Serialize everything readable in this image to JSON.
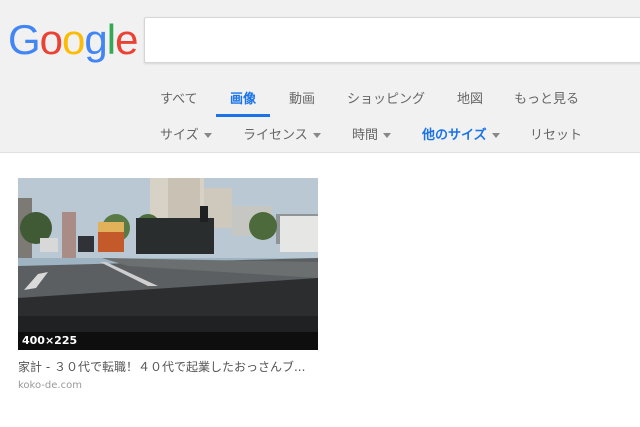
{
  "logo": {
    "letters": [
      "G",
      "o",
      "o",
      "g",
      "l",
      "e"
    ],
    "colors": [
      "#4285f4",
      "#ea4335",
      "#fbbc05",
      "#4285f4",
      "#34a853",
      "#ea4335"
    ]
  },
  "search": {
    "value": "",
    "placeholder": ""
  },
  "tabs": [
    {
      "label": "すべて",
      "active": false
    },
    {
      "label": "画像",
      "active": true
    },
    {
      "label": "動画",
      "active": false
    },
    {
      "label": "ショッピング",
      "active": false
    },
    {
      "label": "地図",
      "active": false
    },
    {
      "label": "もっと見る",
      "active": false
    }
  ],
  "tools": [
    {
      "label": "サイズ",
      "dropdown": true,
      "active": false
    },
    {
      "label": "ライセンス",
      "dropdown": true,
      "active": false
    },
    {
      "label": "時間",
      "dropdown": true,
      "active": false
    },
    {
      "label": "他のサイズ",
      "dropdown": true,
      "active": true
    },
    {
      "label": "リセット",
      "dropdown": false,
      "active": false
    }
  ],
  "result": {
    "dimensions": "400×225",
    "title": "家計 - ３０代で転職！４０代で起業したおっさんブ...",
    "domain": "koko-de.com"
  },
  "colors": {
    "accent": "#1a73e8",
    "header_bg": "#f1f1f1"
  }
}
